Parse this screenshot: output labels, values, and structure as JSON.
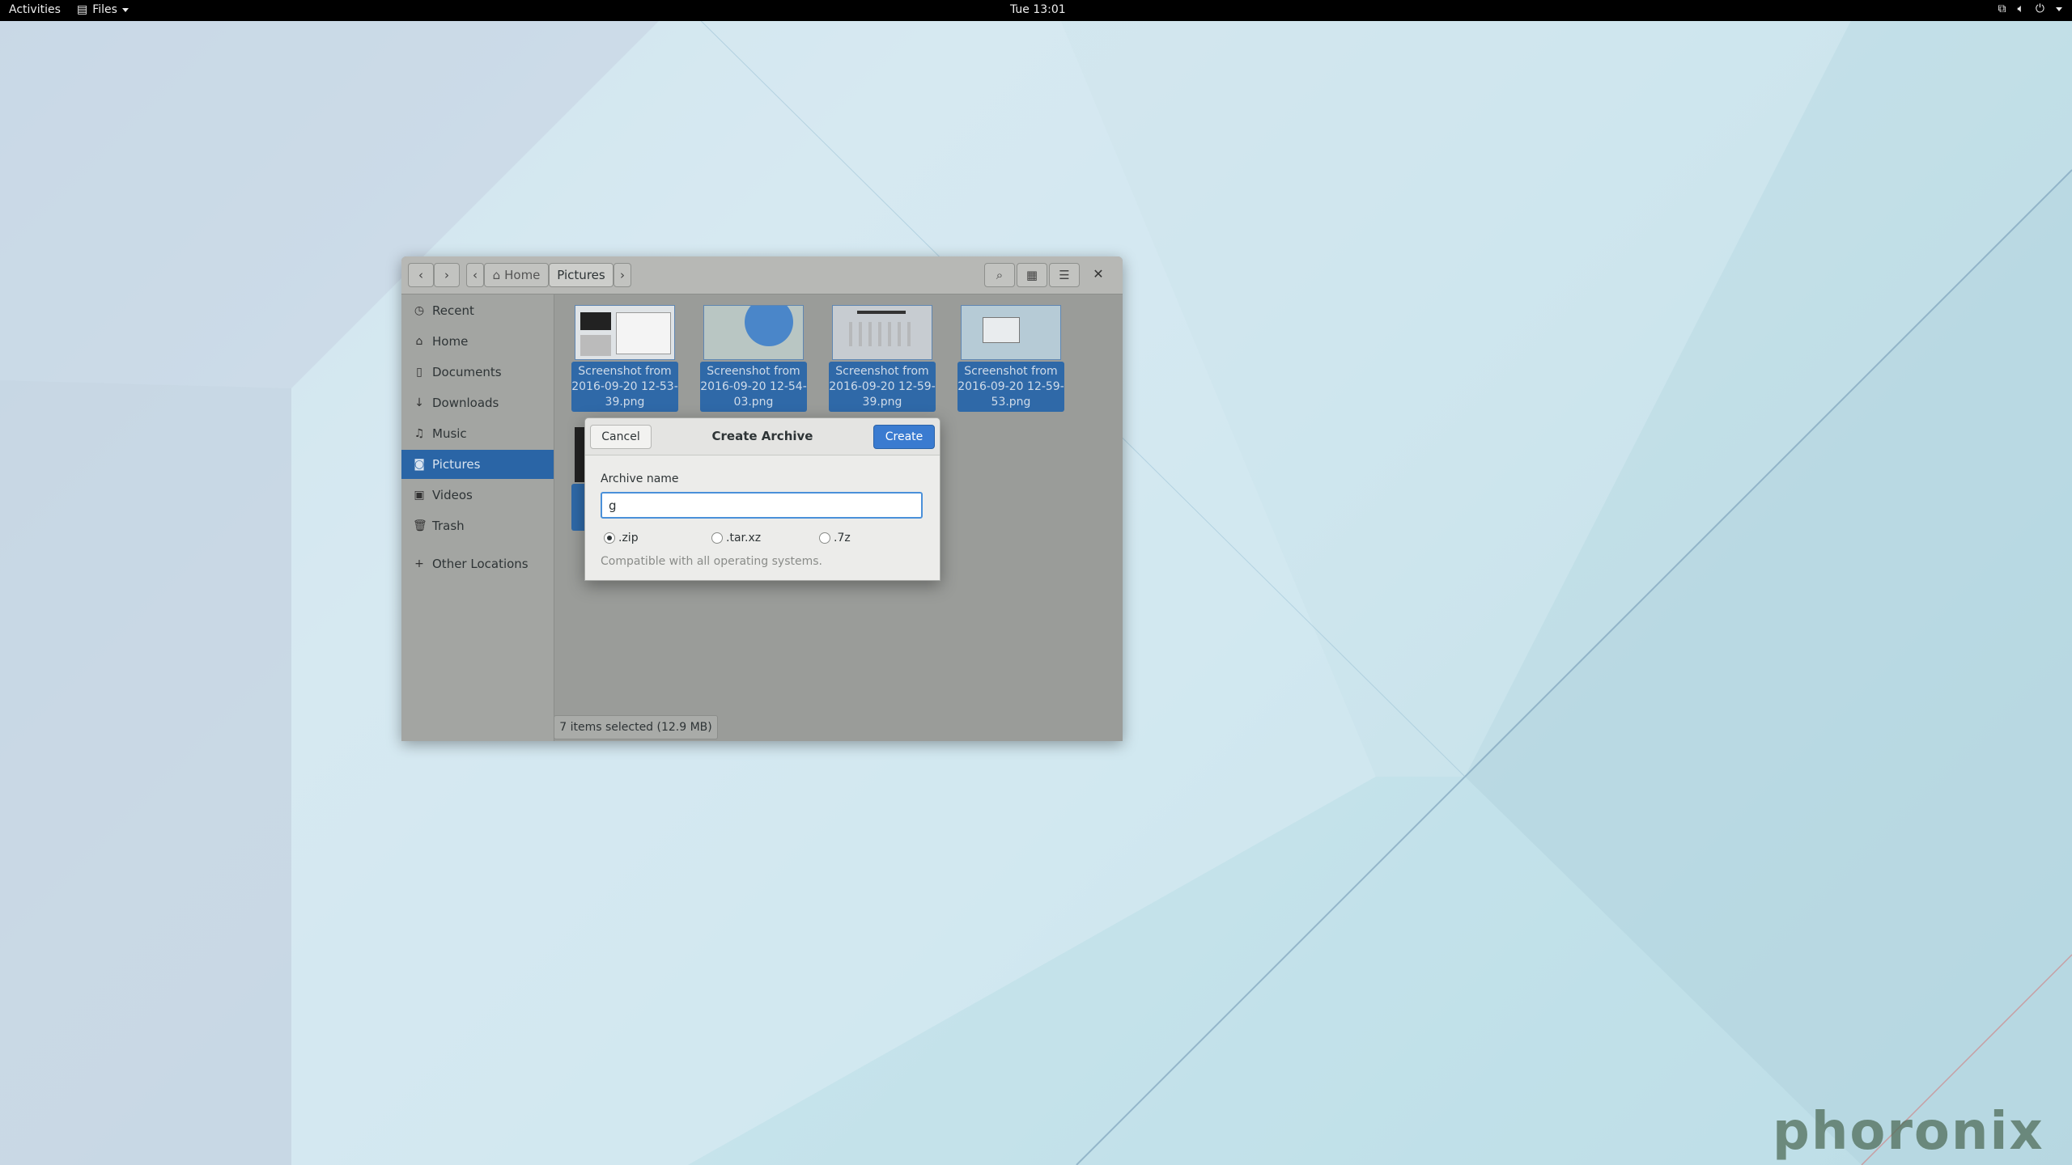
{
  "topbar": {
    "activities": "Activities",
    "app_menu": "Files",
    "clock": "Tue 13:01",
    "tray_icons": [
      "network-icon",
      "volume-icon",
      "power-icon"
    ]
  },
  "window": {
    "breadcrumb": {
      "home": "Home",
      "current": "Pictures"
    },
    "sidebar": {
      "items": [
        {
          "label": "Recent",
          "icon": "clock-icon"
        },
        {
          "label": "Home",
          "icon": "home-icon"
        },
        {
          "label": "Documents",
          "icon": "document-icon"
        },
        {
          "label": "Downloads",
          "icon": "download-icon"
        },
        {
          "label": "Music",
          "icon": "music-icon"
        },
        {
          "label": "Pictures",
          "icon": "camera-icon"
        },
        {
          "label": "Videos",
          "icon": "video-icon"
        },
        {
          "label": "Trash",
          "icon": "trash-icon"
        }
      ],
      "other_locations": "Other Locations"
    },
    "files": [
      {
        "line1": "Screenshot from",
        "line2": "2016-09-20 12-53-",
        "line3": "39.png"
      },
      {
        "line1": "Screenshot from",
        "line2": "2016-09-20 12-54-",
        "line3": "03.png"
      },
      {
        "line1": "Screenshot from",
        "line2": "2016-09-20 12-59-",
        "line3": "39.png"
      },
      {
        "line1": "Screenshot from",
        "line2": "2016-09-20 12-59-",
        "line3": "53.png"
      }
    ],
    "status": "7 items selected  (12.9 MB)"
  },
  "dialog": {
    "title": "Create Archive",
    "cancel": "Cancel",
    "create": "Create",
    "archive_label": "Archive name",
    "archive_value": "g",
    "formats": [
      ".zip",
      ".tar.xz",
      ".7z"
    ],
    "selected_format": ".zip",
    "hint": "Compatible with all operating systems."
  },
  "watermark": "phoronix"
}
